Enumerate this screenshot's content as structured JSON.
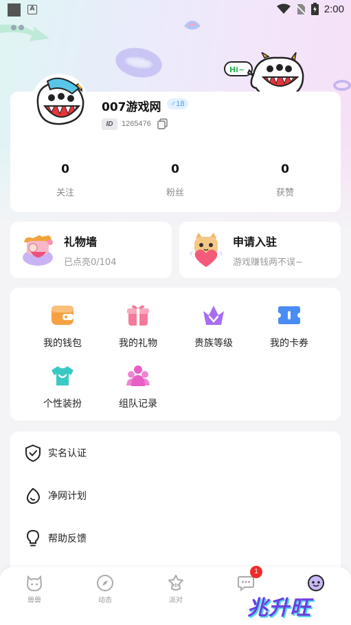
{
  "status_bar": {
    "time": "2:00"
  },
  "decoration": {
    "bubble_text": "Hi~"
  },
  "profile": {
    "username": "007游戏网",
    "gender_badge": "♂18",
    "id_label": "ID",
    "id_value": "1265476",
    "stats": [
      {
        "value": "0",
        "label": "关注"
      },
      {
        "value": "0",
        "label": "粉丝"
      },
      {
        "value": "0",
        "label": "获赞"
      }
    ]
  },
  "feature_cards": [
    {
      "title": "礼物墙",
      "subtitle": "已点亮0/104"
    },
    {
      "title": "申请入驻",
      "subtitle": "游戏赚钱两不误~"
    }
  ],
  "grid": [
    {
      "label": "我的钱包",
      "icon": "wallet-icon",
      "color": "#f5a142"
    },
    {
      "label": "我的礼物",
      "icon": "gift-icon",
      "color": "#f57a9a"
    },
    {
      "label": "贵族等级",
      "icon": "crown-icon",
      "color": "#a66ef0"
    },
    {
      "label": "我的卡券",
      "icon": "ticket-icon",
      "color": "#4a8cf5"
    },
    {
      "label": "个性装扮",
      "icon": "tshirt-icon",
      "color": "#39c9c2"
    },
    {
      "label": "组队记录",
      "icon": "team-icon",
      "color": "#e75fc4"
    }
  ],
  "list": [
    {
      "label": "实名认证",
      "icon": "shield-check-icon"
    },
    {
      "label": "净网计划",
      "icon": "leaf-icon"
    },
    {
      "label": "帮助反馈",
      "icon": "lightbulb-icon"
    }
  ],
  "tabs": [
    {
      "label": "兽兽",
      "icon": "beast-icon"
    },
    {
      "label": "动态",
      "icon": "compass-icon"
    },
    {
      "label": "派对",
      "icon": "party-icon"
    },
    {
      "label": "",
      "icon": "message-icon",
      "badge": "1"
    },
    {
      "label": "",
      "icon": "avatar-icon"
    }
  ],
  "watermark": "兆升旺"
}
